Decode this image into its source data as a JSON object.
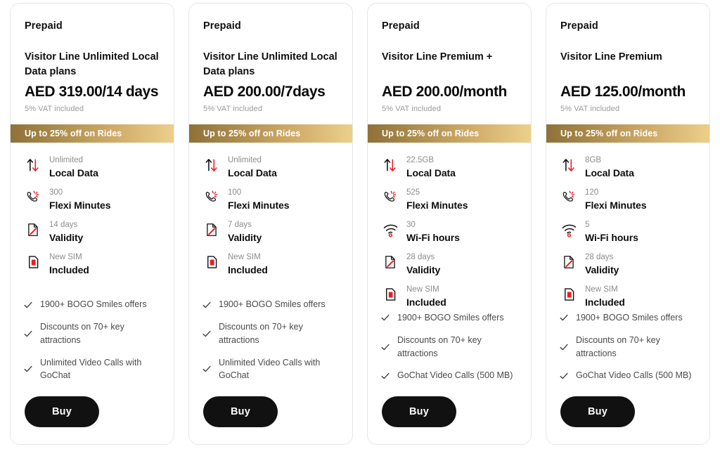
{
  "theme": {
    "accent_red": "#ed1c24",
    "gold_dark": "#8f7139",
    "gold_light": "#ecd08a",
    "button_bg": "#111111",
    "card_border": "#e6e6e6",
    "muted_text": "#8c8c8c"
  },
  "cards": [
    {
      "kicker": "Prepaid",
      "plan_name": "Visitor Line Unlimited Local Data plans",
      "price": "AED 319.00/14 days",
      "vat": "5% VAT included",
      "promo": "Up to 25% off on Rides",
      "features": [
        {
          "icon": "data-transfer-icon",
          "value": "Unlimited",
          "label": "Local Data"
        },
        {
          "icon": "ringing-phone-icon",
          "value": "300",
          "label": "Flexi Minutes"
        },
        {
          "icon": "document-pencil-icon",
          "value": "14 days",
          "label": "Validity"
        },
        {
          "icon": "sim-card-icon",
          "value": "New SIM",
          "label": "Included"
        }
      ],
      "benefits": [
        "1900+ BOGO Smiles offers",
        "Discounts on 70+ key attractions",
        "Unlimited Video Calls with GoChat"
      ],
      "buy_label": "Buy"
    },
    {
      "kicker": "Prepaid",
      "plan_name": "Visitor Line Unlimited Local Data plans",
      "price": "AED 200.00/7days",
      "vat": "5% VAT included",
      "promo": "Up to 25% off on Rides",
      "features": [
        {
          "icon": "data-transfer-icon",
          "value": "Unlimited",
          "label": "Local Data"
        },
        {
          "icon": "ringing-phone-icon",
          "value": "100",
          "label": "Flexi Minutes"
        },
        {
          "icon": "document-pencil-icon",
          "value": "7 days",
          "label": "Validity"
        },
        {
          "icon": "sim-card-icon",
          "value": "New SIM",
          "label": "Included"
        }
      ],
      "benefits": [
        "1900+ BOGO Smiles offers",
        "Discounts on 70+ key attractions",
        "Unlimited Video Calls with GoChat"
      ],
      "buy_label": "Buy"
    },
    {
      "kicker": "Prepaid",
      "plan_name": "Visitor Line Premium +",
      "price": "AED 200.00/month",
      "vat": "5% VAT included",
      "promo": "Up to 25% off on Rides",
      "features": [
        {
          "icon": "data-transfer-icon",
          "value": "22.5GB",
          "label": "Local Data"
        },
        {
          "icon": "ringing-phone-icon",
          "value": "525",
          "label": "Flexi Minutes"
        },
        {
          "icon": "wifi-icon",
          "value": "30",
          "label": "Wi-Fi hours"
        },
        {
          "icon": "document-pencil-icon",
          "value": "28 days",
          "label": "Validity"
        },
        {
          "icon": "sim-card-icon",
          "value": "New SIM",
          "label": "Included"
        }
      ],
      "benefits": [
        "1900+ BOGO Smiles offers",
        "Discounts on 70+ key attractions",
        "GoChat Video Calls (500 MB)"
      ],
      "buy_label": "Buy"
    },
    {
      "kicker": "Prepaid",
      "plan_name": "Visitor Line Premium",
      "price": "AED 125.00/month",
      "vat": "5% VAT included",
      "promo": "Up to 25% off on Rides",
      "features": [
        {
          "icon": "data-transfer-icon",
          "value": "8GB",
          "label": "Local Data"
        },
        {
          "icon": "ringing-phone-icon",
          "value": "120",
          "label": "Flexi Minutes"
        },
        {
          "icon": "wifi-icon",
          "value": "5",
          "label": "Wi-Fi hours"
        },
        {
          "icon": "document-pencil-icon",
          "value": "28 days",
          "label": "Validity"
        },
        {
          "icon": "sim-card-icon",
          "value": "New SIM",
          "label": "Included"
        }
      ],
      "benefits": [
        "1900+ BOGO Smiles offers",
        "Discounts on 70+ key attractions",
        "GoChat Video Calls (500 MB)"
      ],
      "buy_label": "Buy"
    }
  ]
}
